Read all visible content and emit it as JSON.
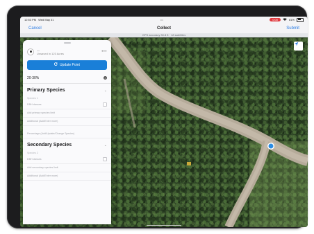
{
  "status_bar": {
    "time": "12:53 PM",
    "date": "Wed May 31",
    "center_dots": "•••",
    "record_pill": "0:00",
    "battery_pct": "81%"
  },
  "nav": {
    "cancel": "Cancel",
    "title": "Collect",
    "submit": "Submit"
  },
  "gps_bar": {
    "text": "GPS accuracy 30.8 ft  ·  18 satellites"
  },
  "sheet": {
    "point": {
      "title": "---",
      "subtitle": "Unsaved in 123 Acres"
    },
    "update_button": "Update Point",
    "percent_range": "20-30%",
    "primary_section": {
      "title": "Primary Species",
      "sub_label": "Species 1",
      "fields": [
        "DBH classes",
        "Add primary species limit",
        "Additional (Add/Enter more)",
        "Percentage (Add/Update/Change Species)"
      ]
    },
    "secondary_section": {
      "title": "Secondary Species",
      "sub_label": "Species 2",
      "fields": [
        "DBH classes",
        "Add secondary species limit",
        "Additional (Add/Enter more)"
      ]
    }
  },
  "map": {
    "location_marker_color": "#2a8be4",
    "road_color": "#b6ab9a",
    "forest_color": "#2e4426"
  },
  "colors": {
    "accent": "#1a7fd8",
    "cancel_text": "#2a7be4",
    "record": "#e0393e"
  },
  "side_buttons": [
    "#f2d200",
    "#f2d200",
    "#2a9be0",
    "#2a9be0"
  ]
}
